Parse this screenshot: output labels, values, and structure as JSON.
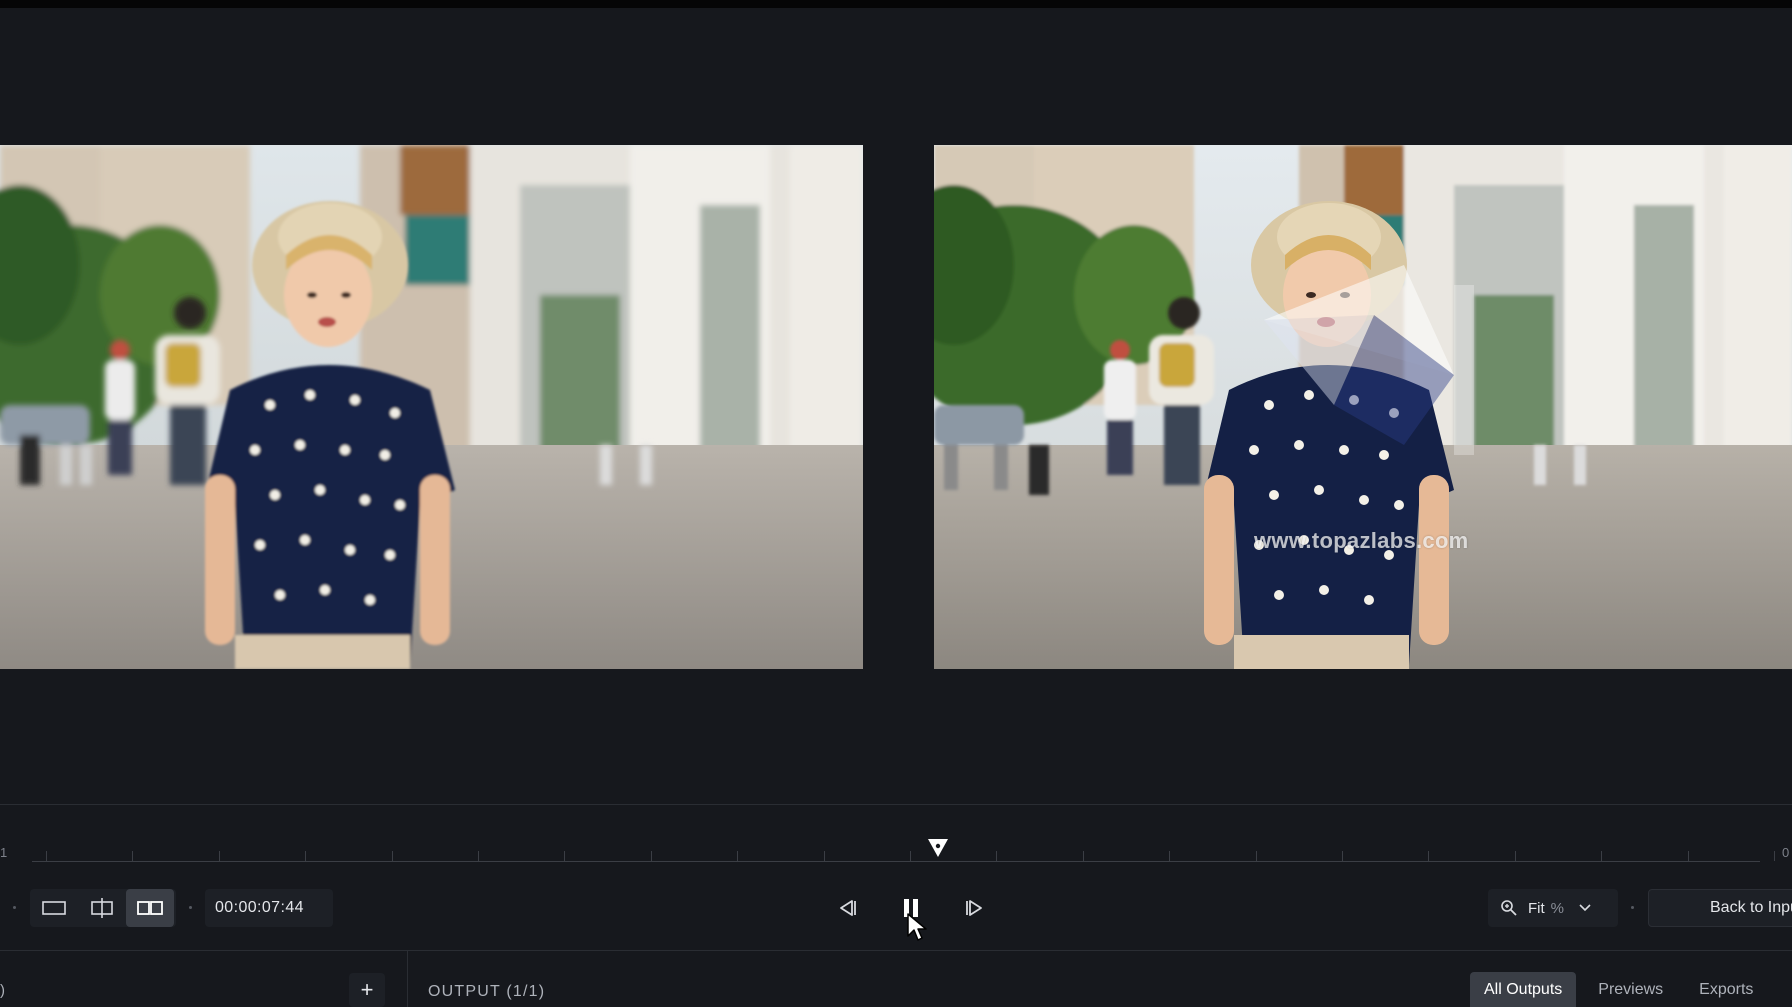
{
  "timeline": {
    "left_edge_label": "1",
    "right_edge_label": "0"
  },
  "controls": {
    "timecode": "00:00:07:44",
    "zoom_label": "Fit",
    "zoom_unit": "%",
    "back_button_label": "Back to Input",
    "view_modes": [
      "single-view",
      "split-view",
      "side-by-side-view"
    ],
    "active_view_mode": "side-by-side-view",
    "play_state": "playing"
  },
  "preview": {
    "watermark": "www.topazlabs.com"
  },
  "bottom": {
    "left_fragment": ")",
    "add_label": "+",
    "output_label": "OUTPUT (1/1)",
    "tabs": [
      {
        "label": "All Outputs",
        "active": true
      },
      {
        "label": "Previews",
        "active": false
      },
      {
        "label": "Exports",
        "active": false
      }
    ]
  },
  "colors": {
    "background": "#16181d",
    "panel": "#1d2026",
    "active_tab": "#3a3e46",
    "text": "#e4e6ea"
  }
}
